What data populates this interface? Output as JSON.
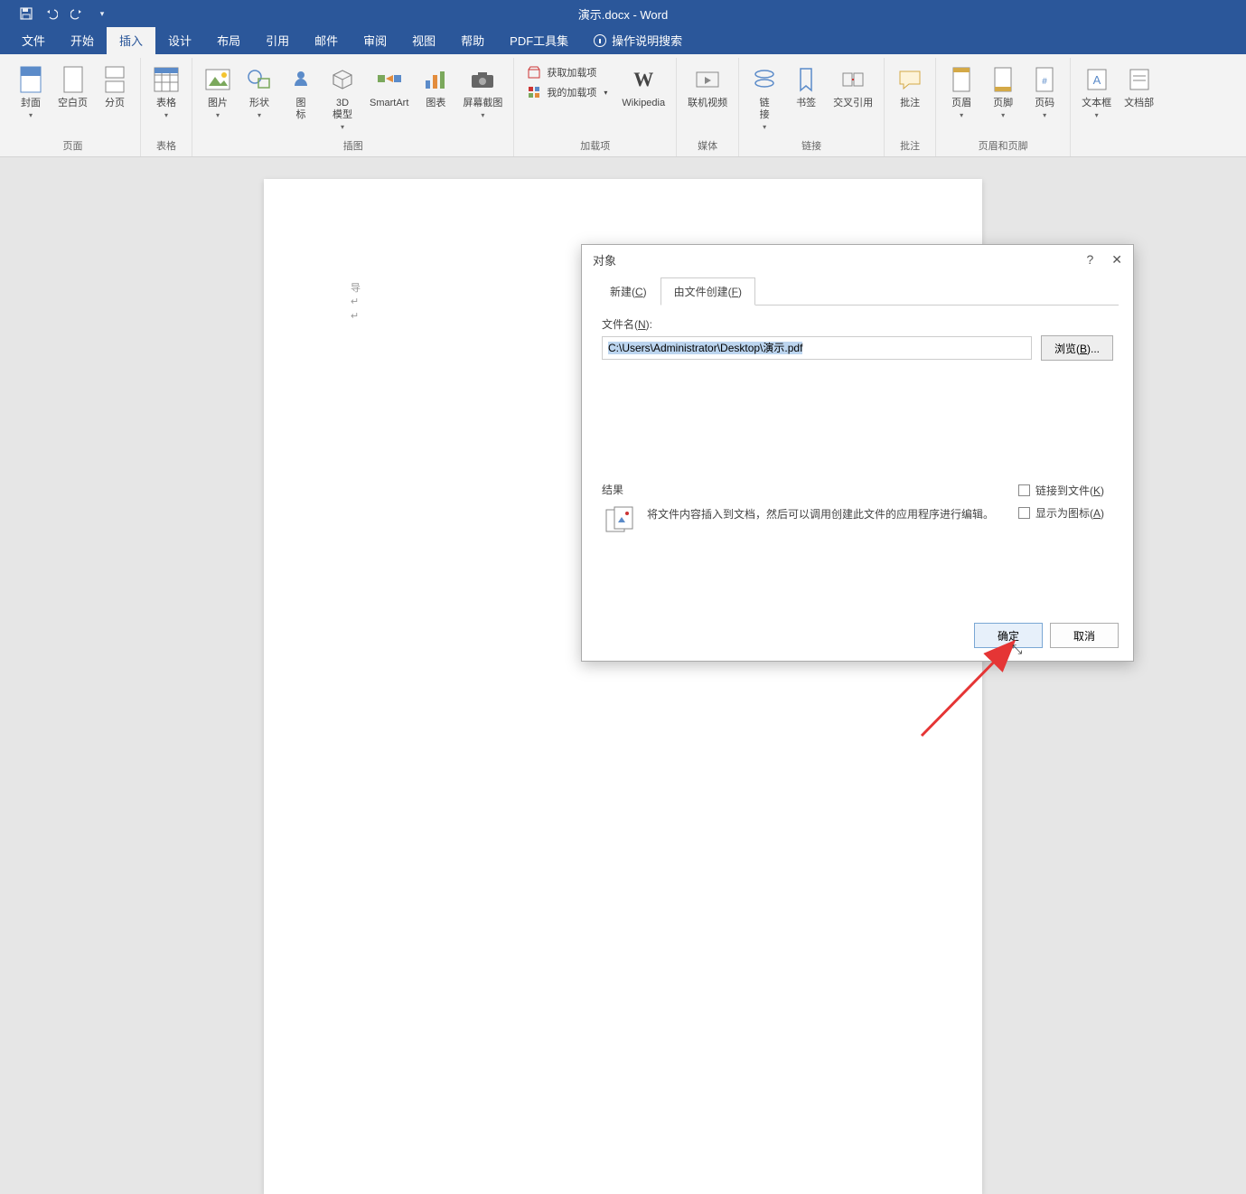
{
  "title": "演示.docx - Word",
  "qat": {
    "save": "save-icon",
    "undo": "undo-icon",
    "redo": "redo-icon"
  },
  "menu": {
    "file": "文件",
    "home": "开始",
    "insert": "插入",
    "design": "设计",
    "layout": "布局",
    "references": "引用",
    "mailings": "邮件",
    "review": "审阅",
    "view": "视图",
    "help": "帮助",
    "pdf": "PDF工具集",
    "tell_me": "操作说明搜索"
  },
  "ribbon": {
    "pages": {
      "label": "页面",
      "cover": "封面",
      "blank": "空白页",
      "break": "分页"
    },
    "tables": {
      "label": "表格",
      "table": "表格"
    },
    "illustrations": {
      "label": "插图",
      "pictures": "图片",
      "shapes": "形状",
      "icons": "图\n标",
      "model": "3D\n模型",
      "smartart": "SmartArt",
      "chart": "图表",
      "screenshot": "屏幕截图"
    },
    "addins": {
      "label": "加载项",
      "get": "获取加载项",
      "my": "我的加载项",
      "wikipedia": "Wikipedia"
    },
    "media": {
      "label": "媒体",
      "video": "联机视频"
    },
    "links": {
      "label": "链接",
      "link": "链\n接",
      "bookmark": "书签",
      "crossref": "交叉引用"
    },
    "comments": {
      "label": "批注",
      "comment": "批注"
    },
    "header": {
      "label": "页眉和页脚",
      "hdr": "页眉",
      "ftr": "页脚",
      "pgnum": "页码"
    },
    "text": {
      "textbox": "文本框",
      "parts": "文档部"
    }
  },
  "page_marks": {
    "line1": "导",
    "line2": "↵",
    "line3": "↵"
  },
  "dialog": {
    "title": "对象",
    "help": "?",
    "close": "✕",
    "tab_create": "新建(C)",
    "tab_fromfile": "由文件创建(F)",
    "filename_label": "文件名(N):",
    "filename_value": "C:\\Users\\Administrator\\Desktop\\演示.pdf",
    "browse": "浏览(B)...",
    "check_link": "链接到文件(K)",
    "check_icon": "显示为图标(A)",
    "result_label": "结果",
    "result_text": "将文件内容插入到文档，然后可以调用创建此文件的应用程序进行编辑。",
    "ok": "确定",
    "cancel": "取消"
  }
}
